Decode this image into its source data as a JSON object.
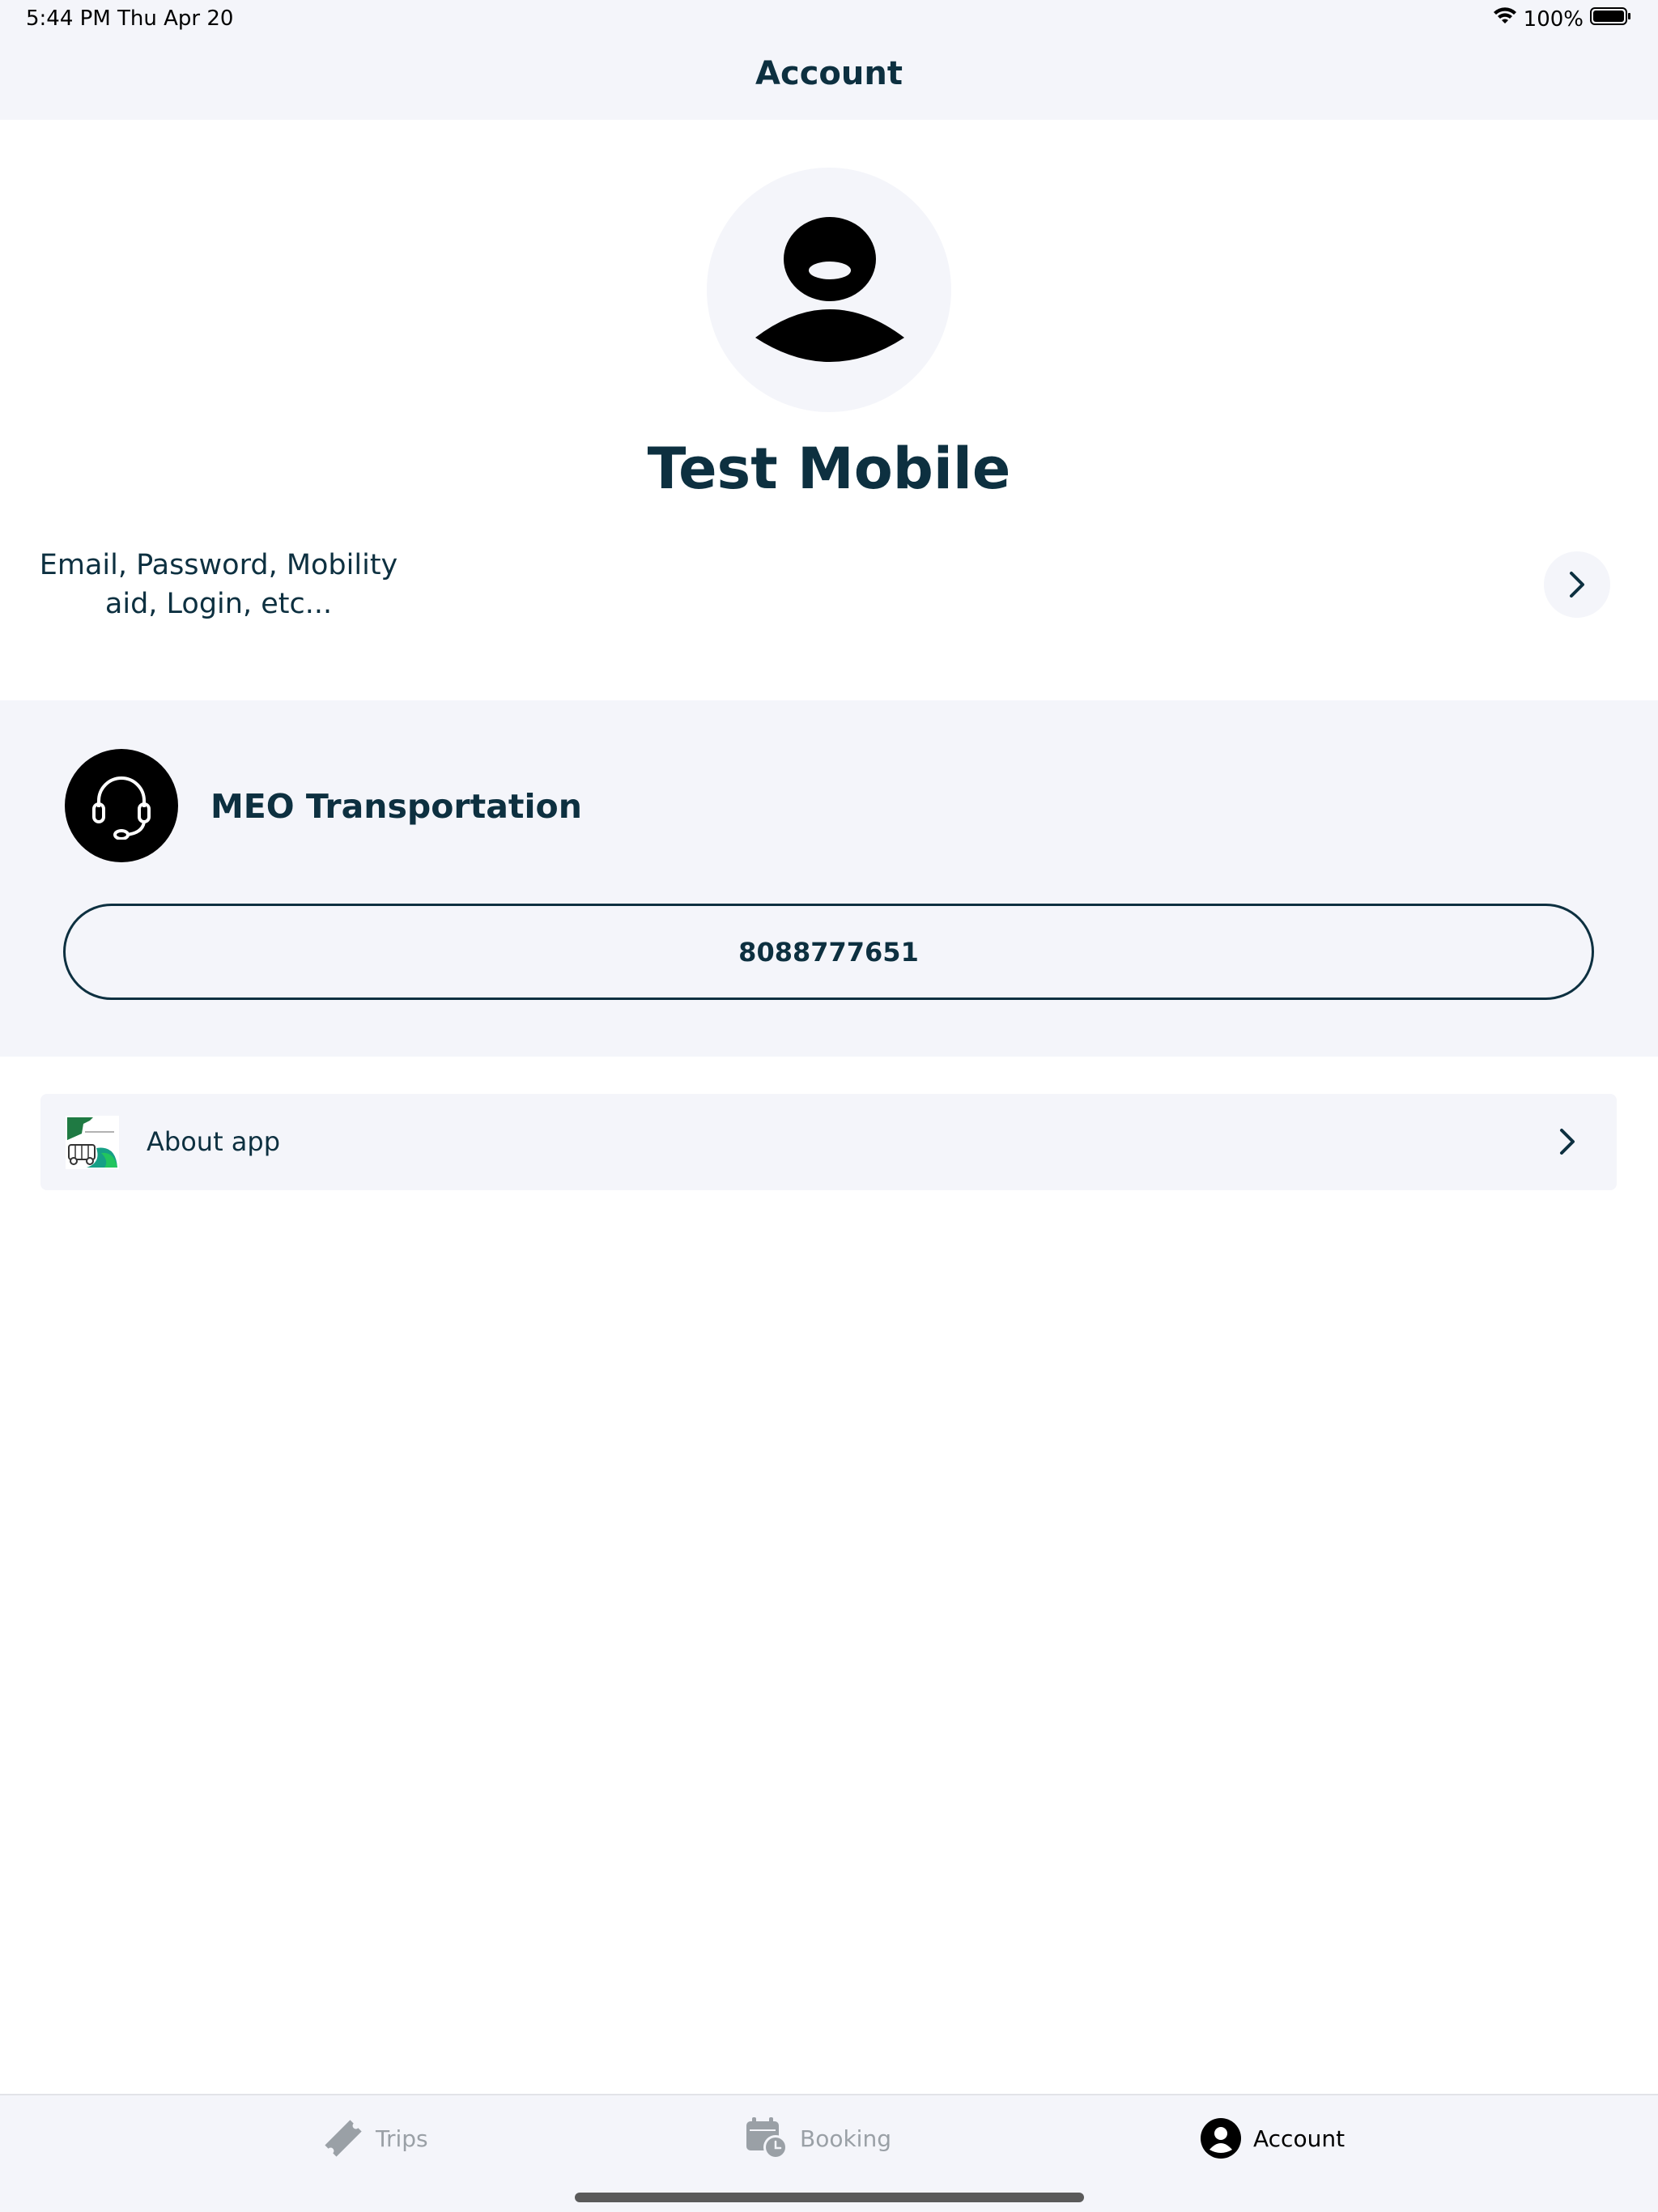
{
  "status_bar": {
    "time_date": "5:44 PM   Thu Apr 20",
    "battery": "100%"
  },
  "nav": {
    "title": "Account"
  },
  "profile": {
    "name": "Test Mobile",
    "description_line1": "Email, Password, Mobility",
    "description_line2": "aid, Login, etc..."
  },
  "support": {
    "name": "MEO Transportation",
    "phone": "8088777651"
  },
  "about": {
    "label": "About app"
  },
  "tabs": [
    {
      "label": "Trips",
      "icon": "ticket-icon",
      "active": false
    },
    {
      "label": "Booking",
      "icon": "calendar-clock-icon",
      "active": false
    },
    {
      "label": "Account",
      "icon": "user-circle-icon",
      "active": true
    }
  ],
  "colors": {
    "primary_text": "#0d3040",
    "panel_bg": "#f4f5fa",
    "inactive_tab": "#9aa0a6"
  }
}
